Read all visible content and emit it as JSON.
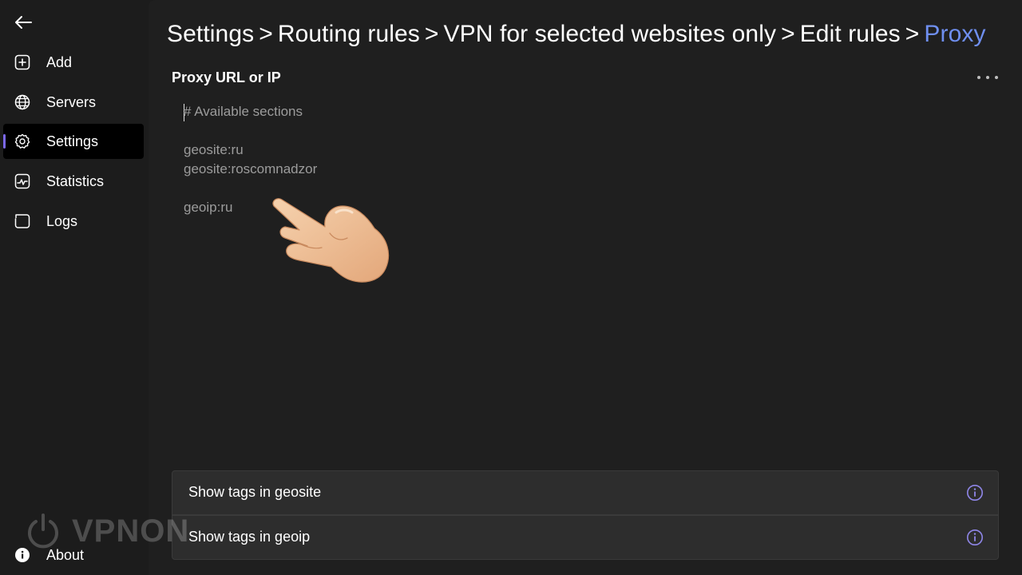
{
  "sidebar": {
    "back_icon": "arrow-left-icon",
    "items": [
      {
        "label": "Add",
        "icon": "plus-square-icon"
      },
      {
        "label": "Servers",
        "icon": "globe-icon"
      },
      {
        "label": "Settings",
        "icon": "gear-icon",
        "active": true
      },
      {
        "label": "Statistics",
        "icon": "chart-icon"
      },
      {
        "label": "Logs",
        "icon": "logs-icon"
      }
    ],
    "about": {
      "label": "About",
      "icon": "info-icon"
    }
  },
  "breadcrumb": {
    "items": [
      "Settings",
      "Routing rules",
      "VPN for selected websites only",
      "Edit rules"
    ],
    "separator": ">",
    "current": "Proxy"
  },
  "field": {
    "label": "Proxy URL or IP",
    "lines": [
      "# Available sections",
      "geosite:ru",
      "geosite:roscomnadzor",
      "geoip:ru"
    ]
  },
  "toggles": [
    {
      "label": "Show tags in geosite"
    },
    {
      "label": "Show tags in geoip"
    }
  ],
  "watermark": {
    "text": "VPNON"
  },
  "colors": {
    "accent": "#7b68ee",
    "breadcrumb_current": "#6f8ff0",
    "background": "#1f1f1f",
    "sidebar": "#1c1c1c"
  }
}
